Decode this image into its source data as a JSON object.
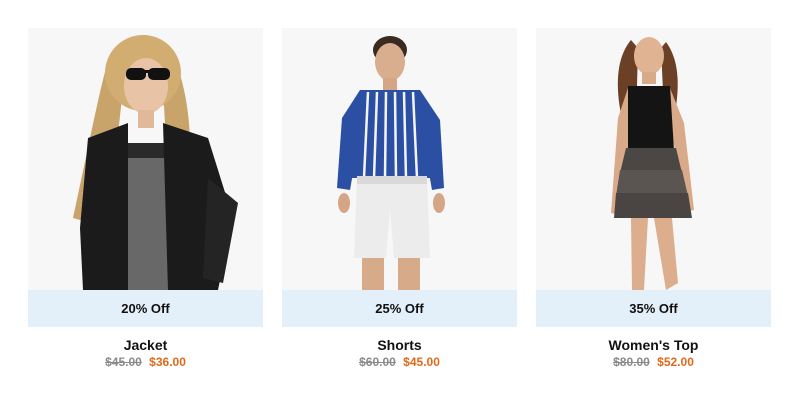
{
  "products": [
    {
      "name": "Jacket",
      "discount": "20% Off",
      "old_price": "$45.00",
      "new_price": "$36.00",
      "image_alt": "Woman in black leather jacket and sunglasses"
    },
    {
      "name": "Shorts",
      "discount": "25% Off",
      "old_price": "$60.00",
      "new_price": "$45.00",
      "image_alt": "Man in blue striped shirt and white shorts"
    },
    {
      "name": "Women's Top",
      "discount": "35% Off",
      "old_price": "$80.00",
      "new_price": "$52.00",
      "image_alt": "Woman in black top and tiered skirt"
    }
  ],
  "colors": {
    "discount_bar": "#e3f0fa",
    "sale_price": "#e06a1c",
    "old_price": "#8a8a8a",
    "image_background": "#f8f7f8"
  }
}
